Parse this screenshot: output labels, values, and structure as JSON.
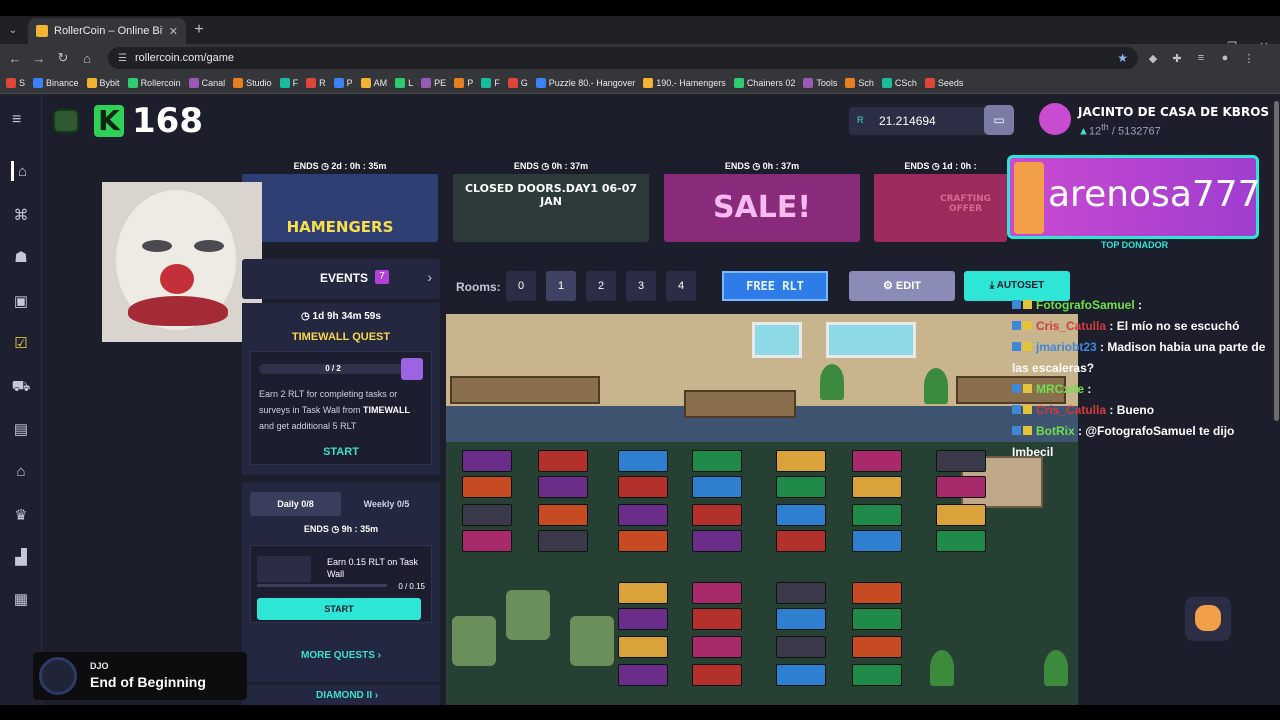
{
  "browser": {
    "tab_title": "RollerCoin – Online Bitcoin Mi",
    "url": "rollercoin.com/game",
    "bookmarks": [
      "S",
      "Binance",
      "Bybit",
      "Rollercoin",
      "Canal",
      "Studio",
      "F",
      "R",
      "P",
      "AM",
      "L",
      "PE",
      "P",
      "F",
      "G",
      "Puzzle 80.- Hangover",
      "190.- Hamengers",
      "Chainers 02",
      "Tools",
      "Sch",
      "CSch",
      "Seeds"
    ]
  },
  "header": {
    "kscore": "168",
    "k_letter": "K",
    "balance": "21.214694",
    "balance_coin": "R",
    "username": "JACINTO DE CASA DE KBROS",
    "rank_place": "12",
    "rank_suffix": "th",
    "rank_total": "/ 5132767"
  },
  "banners": [
    {
      "ends": "ENDS  ◷  2d : 0h : 35m",
      "text": "HAMENGERS",
      "bg": "#2f3f74"
    },
    {
      "ends": "ENDS  ◷  0h : 37m",
      "text": "CLOSED DOORS.DAY1 06-07 JAN",
      "bg": "#2c3a3a"
    },
    {
      "ends": "ENDS  ◷  0h : 37m",
      "text": "SALE!",
      "bg": "#8a2a7a"
    },
    {
      "ends": "ENDS  ◷  1d : 0h :",
      "text": "CRAFTING OFFER",
      "bg": "#9d2a5c"
    }
  ],
  "donor": {
    "name": "arenosa777",
    "label": "TOP DONADOR"
  },
  "events": {
    "title": "EVENTS",
    "count": "7"
  },
  "quest": {
    "timer": "◷  1d 9h 34m 59s",
    "title": "TIMEWALL QUEST",
    "progress": "0 / 2",
    "desc_1": "Earn 2 RLT for completing tasks or surveys in Task Wall from ",
    "desc_brand": "TIMEWALL",
    "desc_2": " and get additional 5 RLT",
    "start": "START"
  },
  "daily": {
    "tab_daily": "Daily  0/8",
    "tab_weekly": "Weekly  0/5",
    "ends": "ENDS  ◷  9h : 35m",
    "task": "Earn 0.15 RLT on Task Wall",
    "progress": "0 / 0.15",
    "start": "START",
    "more": "MORE QUESTS  ›"
  },
  "diamond": "DIAMOND II  ›",
  "rooms": {
    "label": "Rooms:",
    "numbers": [
      "0",
      "1",
      "2",
      "3",
      "4"
    ],
    "selected": "1"
  },
  "actions": {
    "free_rlt": "FREE RLT",
    "edit": "EDIT",
    "autoset": "AUTOSET"
  },
  "chat": [
    {
      "name": "FotografoSamuel",
      "name_color": "#6ee04b",
      "msg": " : "
    },
    {
      "name": "Cris_Catulla",
      "name_color": "#d13b3b",
      "msg": " : El mío no se escuchó"
    },
    {
      "name": "jmariobt23",
      "name_color": "#3f88d8",
      "msg": " : Madison habia una parte de las escaleras?"
    },
    {
      "name": "MRCxde",
      "name_color": "#6ee04b",
      "msg": " : "
    },
    {
      "name": "Cris_Catulla",
      "name_color": "#d13b3b",
      "msg": " : Bueno"
    },
    {
      "name": "BotRix",
      "name_color": "#6ee04b",
      "msg": " : @FotografoSamuel te dijo Imbecil"
    }
  ],
  "music": {
    "artist": "DJO",
    "song": "End of Beginning"
  }
}
